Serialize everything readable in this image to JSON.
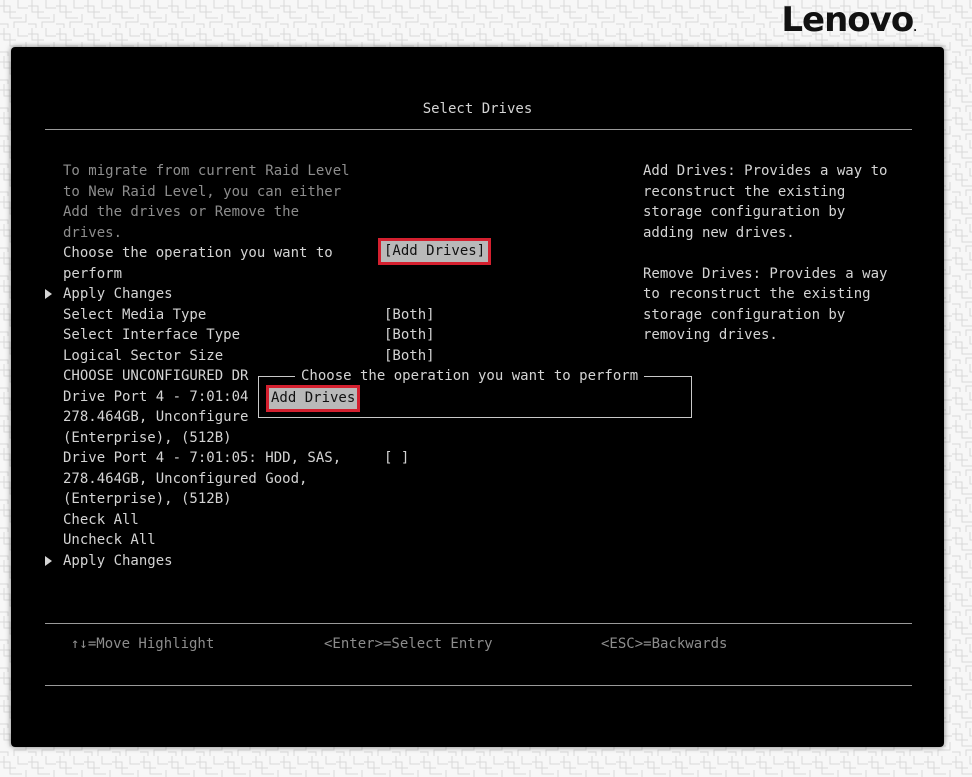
{
  "brand": {
    "logo": "Lenovo",
    "logo_mark": "."
  },
  "screen": {
    "title": "Select Drives",
    "form": {
      "description_lines": [
        "To migrate from current Raid Level",
        "to New Raid Level, you can either",
        "Add the drives or Remove the",
        "drives."
      ],
      "operation_label_lines": [
        "Choose the operation you want to",
        "perform"
      ],
      "operation_value": "[Add Drives]",
      "apply_changes_1": "Apply Changes",
      "media_type_label": "Select Media Type",
      "media_type_value": "[Both]",
      "interface_type_label": "Select Interface Type",
      "interface_type_value": "[Both]",
      "sector_size_label": "Logical Sector Size",
      "sector_size_value": "[Both]",
      "unconfigured_heading": "CHOOSE UNCONFIGURED DR",
      "drive1_lines": [
        "Drive Port 4 - 7:01:04",
        "278.464GB, Unconfigure",
        "(Enterprise), (512B)"
      ],
      "drive2_lines": [
        "Drive Port 4 - 7:01:05: HDD, SAS,",
        "278.464GB, Unconfigured Good,",
        "(Enterprise), (512B)"
      ],
      "drive2_checkbox": "[ ]",
      "check_all": "Check All",
      "uncheck_all": "Uncheck All",
      "apply_changes_2": "Apply Changes"
    },
    "help": {
      "add_lines": [
        "Add Drives: Provides a way to",
        "reconstruct the existing",
        "storage configuration by",
        "adding new drives."
      ],
      "remove_lines": [
        "Remove Drives: Provides a way",
        "to reconstruct the existing",
        "storage configuration by",
        "removing drives."
      ]
    },
    "popup": {
      "title": "Choose the operation you want to perform",
      "option": "Add Drives"
    },
    "footer": {
      "move": "↑↓=Move Highlight",
      "select": "<Enter>=Select Entry",
      "back": "<ESC>=Backwards"
    }
  },
  "colors": {
    "screen_bg": "#000000",
    "text": "#d4d4d4",
    "dim_text": "#8d8d8d",
    "highlight_bg": "#b9b9b9",
    "annotation_red": "#d4202f"
  }
}
